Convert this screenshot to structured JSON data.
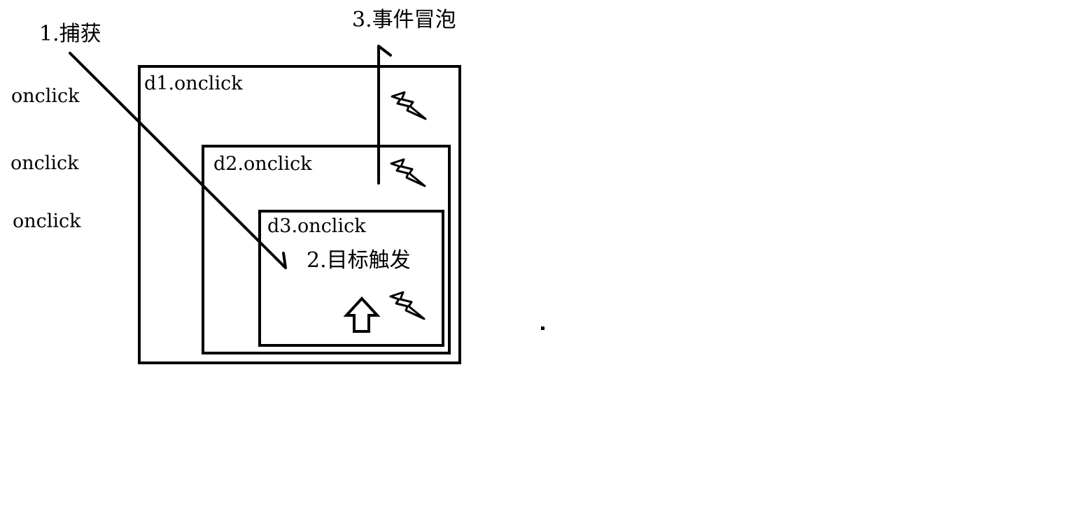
{
  "side_labels": [
    "onclick",
    "onclick",
    "onclick"
  ],
  "boxes": {
    "d1": "d1.onclick",
    "d2": "d2.onclick",
    "d3": "d3.onclick"
  },
  "steps": {
    "capture": "1.捕获",
    "target": "2.目标触发",
    "bubble": "3.事件冒泡"
  },
  "icons": [
    "lightning-icon",
    "lightning-icon",
    "lightning-icon",
    "up-arrow-icon"
  ],
  "colors": {
    "stroke": "#000000",
    "background": "#ffffff"
  }
}
